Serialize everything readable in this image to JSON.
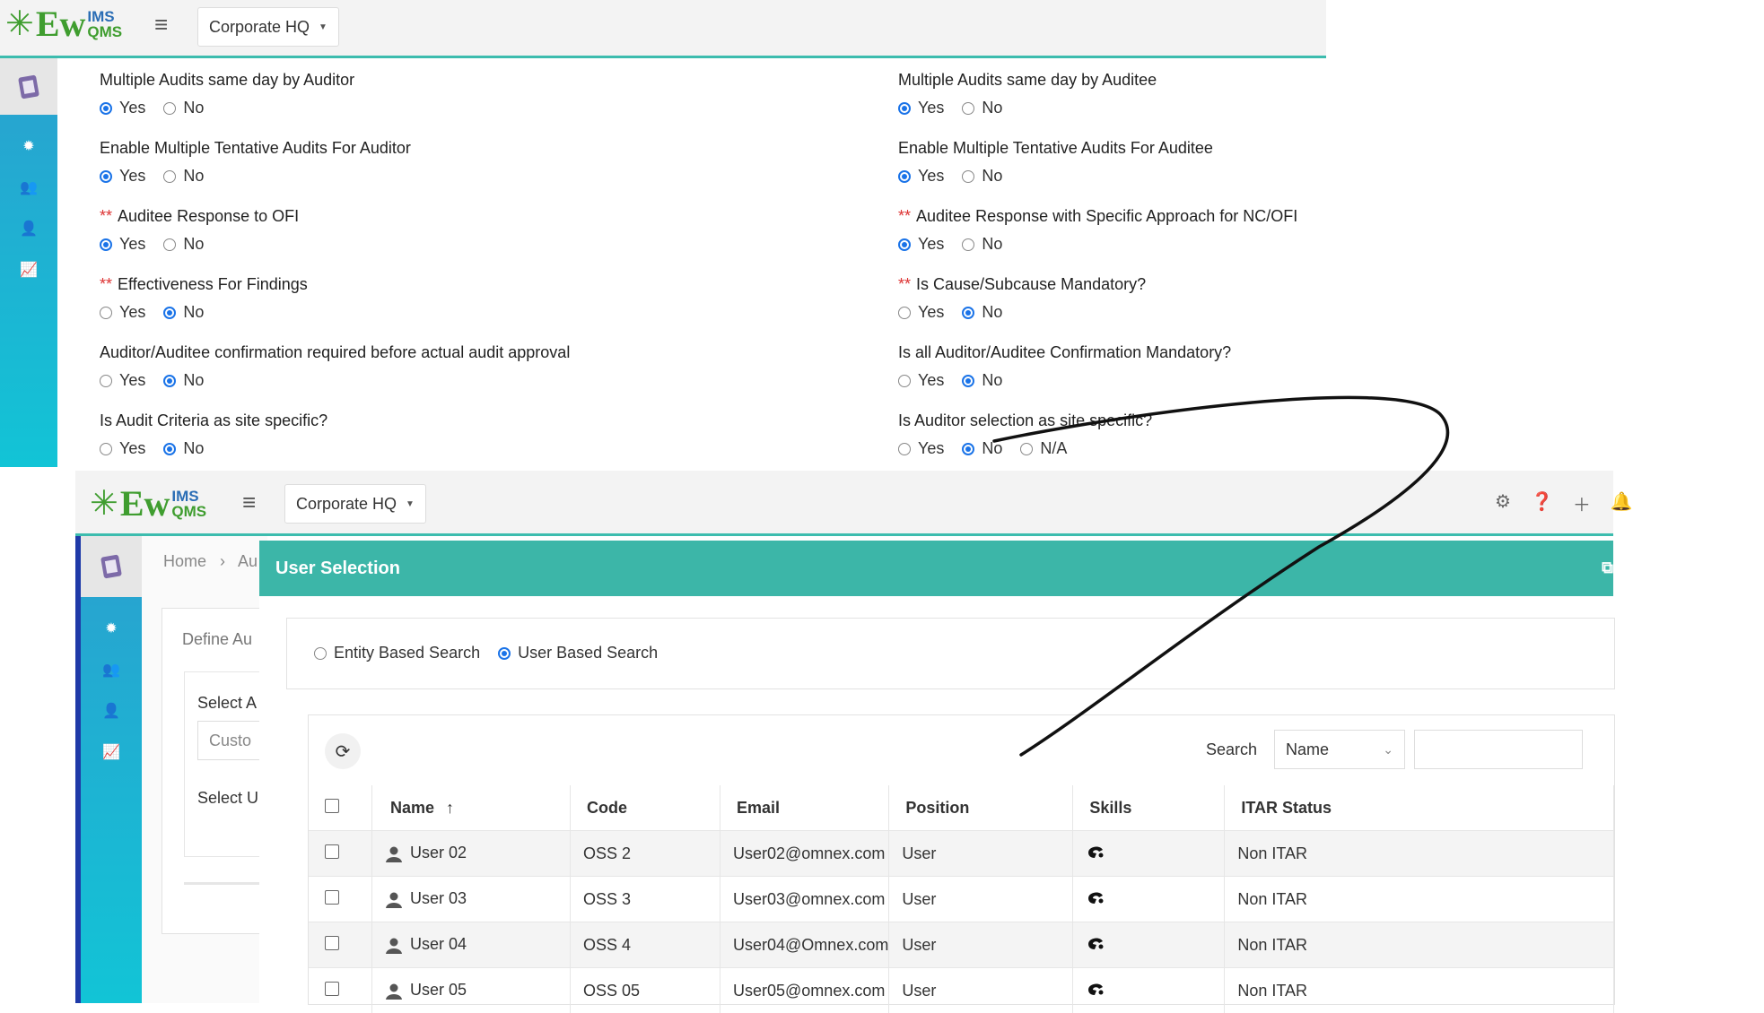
{
  "top": {
    "logo": {
      "ew": "Ew",
      "ims": "IMS",
      "qms": "QMS"
    },
    "site": "Corporate HQ",
    "questions_left": [
      {
        "label": "Multiple Audits same day by Auditor",
        "required": false,
        "options": [
          "Yes",
          "No"
        ],
        "selected": "Yes"
      },
      {
        "label": "Enable Multiple Tentative Audits For Auditor",
        "required": false,
        "options": [
          "Yes",
          "No"
        ],
        "selected": "Yes"
      },
      {
        "label": "Auditee Response to OFI",
        "required": true,
        "options": [
          "Yes",
          "No"
        ],
        "selected": "Yes"
      },
      {
        "label": "Effectiveness For Findings",
        "required": true,
        "options": [
          "Yes",
          "No"
        ],
        "selected": "No"
      },
      {
        "label": "Auditor/Auditee confirmation required before actual audit approval",
        "required": false,
        "options": [
          "Yes",
          "No"
        ],
        "selected": "No"
      },
      {
        "label": "Is Audit Criteria as site specific?",
        "required": false,
        "options": [
          "Yes",
          "No"
        ],
        "selected": "No"
      }
    ],
    "questions_right": [
      {
        "label": "Multiple Audits same day by Auditee",
        "required": false,
        "options": [
          "Yes",
          "No"
        ],
        "selected": "Yes"
      },
      {
        "label": "Enable Multiple Tentative Audits For Auditee",
        "required": false,
        "options": [
          "Yes",
          "No"
        ],
        "selected": "Yes"
      },
      {
        "label": "Auditee Response with Specific Approach for NC/OFI",
        "required": true,
        "options": [
          "Yes",
          "No"
        ],
        "selected": "Yes"
      },
      {
        "label": "Is Cause/Subcause Mandatory?",
        "required": true,
        "options": [
          "Yes",
          "No"
        ],
        "selected": "No"
      },
      {
        "label": "Is all Auditor/Auditee Confirmation Mandatory?",
        "required": false,
        "options": [
          "Yes",
          "No"
        ],
        "selected": "No"
      },
      {
        "label": "Is Auditor selection as site specific?",
        "required": false,
        "options": [
          "Yes",
          "No",
          "N/A"
        ],
        "selected": "No"
      }
    ],
    "required_mark": "**"
  },
  "bottom": {
    "site": "Corporate HQ",
    "breadcrumb": {
      "home": "Home",
      "sep": "›",
      "next": "Au"
    },
    "bg_labels": {
      "define": "Define Au",
      "select_a": "Select A",
      "custo": "Custo",
      "select_u": "Select U"
    },
    "modal": {
      "title": "User Selection",
      "search_modes": [
        "Entity Based Search",
        "User Based Search"
      ],
      "selected_mode": "User Based Search",
      "search_label": "Search",
      "search_field": "Name",
      "search_value": "",
      "columns": [
        "Name",
        "Code",
        "Email",
        "Position",
        "Skills",
        "ITAR Status"
      ],
      "sort_arrow": "↑",
      "rows": [
        {
          "name": "User 02",
          "code": "OSS 2",
          "email": "User02@omnex.com",
          "position": "User",
          "itar": "Non ITAR"
        },
        {
          "name": "User 03",
          "code": "OSS 3",
          "email": "User03@omnex.com",
          "position": "User",
          "itar": "Non ITAR"
        },
        {
          "name": "User 04",
          "code": "OSS 4",
          "email": "User04@Omnex.com",
          "position": "User",
          "itar": "Non ITAR"
        },
        {
          "name": "User 05",
          "code": "OSS 05",
          "email": "User05@omnex.com",
          "position": "User",
          "itar": "Non ITAR"
        }
      ]
    }
  },
  "colors": {
    "teal": "#3cb6a8",
    "sidebar": "#12c4d6",
    "radio": "#1a73e8",
    "required": "#d33333"
  }
}
